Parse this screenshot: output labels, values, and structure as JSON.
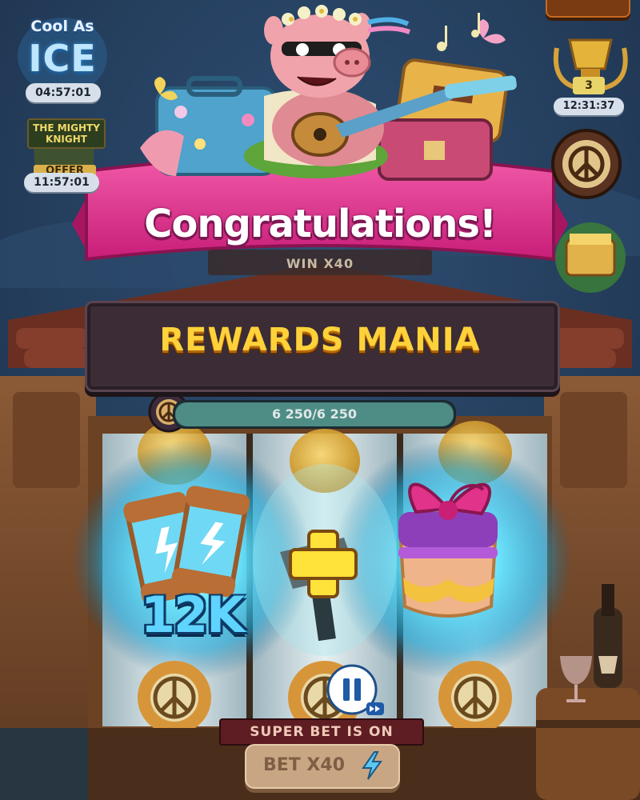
{
  "events": {
    "cool_as_ice": {
      "line1": "Cool As",
      "line2": "ICE",
      "timer": "04:57:01"
    },
    "mighty_knight": {
      "title": "THE MIGHTY KNIGHT",
      "label": "OFFER",
      "timer": "11:57:01"
    },
    "trophy": {
      "rank": "3",
      "timer": "12:31:37"
    }
  },
  "banner": {
    "title": "Congratulations!",
    "behind_text": "WIN X40"
  },
  "machine": {
    "title": "REWARDS MANIA"
  },
  "progress": {
    "current": 6250,
    "max": 6250,
    "label": "6 250/6 250"
  },
  "rewards": {
    "coins_amount": "12K",
    "icons": [
      "energy-capsules-icon",
      "plus-icon",
      "gift-box-icon"
    ]
  },
  "controls": {
    "super_bet_text": "SUPER BET IS ON",
    "bet_label": "BET X40"
  },
  "colors": {
    "banner_pink": "#e0338f",
    "title_gold": "#ffd23a",
    "glow_cyan": "#35d6ff",
    "wall_blue": "#233d5c"
  }
}
